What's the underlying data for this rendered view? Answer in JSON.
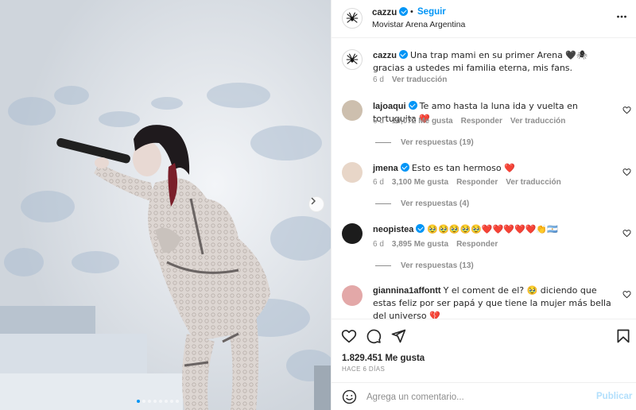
{
  "colors": {
    "accent": "#0095f6",
    "text": "#262626",
    "muted": "#8e8e8e",
    "like_red": "#ed4956"
  },
  "media": {
    "slide_index": 1,
    "slide_count": 8,
    "next_icon": "chevron-right-icon"
  },
  "header": {
    "username": "cazzu",
    "separator": "•",
    "follow_label": "Seguir",
    "location": "Movistar Arena Argentina",
    "more_icon": "more-horizontal-icon"
  },
  "caption": {
    "username": "cazzu",
    "text": "Una trap mami en su primer Arena 🖤🕷 gracias a ustedes mi familia eterna, mis fans.",
    "time": "6 d",
    "translate": "Ver traducción"
  },
  "comments": [
    {
      "username": "lajoaqui",
      "verified": true,
      "text": "Te amo hasta la luna ida y vuelta en tortuguita ❤️",
      "time": "6 d",
      "likes": "10,072 Me gusta",
      "reply": "Responder",
      "translate": "Ver traducción",
      "replies": "Ver respuestas (19)"
    },
    {
      "username": "jmena",
      "verified": true,
      "text": "Esto es tan hermoso ❤️",
      "time": "6 d",
      "likes": "3,100 Me gusta",
      "reply": "Responder",
      "translate": "Ver traducción",
      "replies": "Ver respuestas (4)"
    },
    {
      "username": "neopistea",
      "verified": true,
      "text": "🥹🥹🥹🥹🥹❤️❤️❤️❤️❤️👏🇦🇷",
      "time": "6 d",
      "likes": "3,895 Me gusta",
      "reply": "Responder",
      "replies": "Ver respuestas (13)"
    },
    {
      "username": "giannina1affontt",
      "verified": false,
      "text": "Y el coment de el? 🥹 diciendo que estas feliz por ser papá y que tiene la mujer más bella del universo 💔"
    }
  ],
  "actions": {
    "like_icon": "heart-icon",
    "comment_icon": "comment-icon",
    "share_icon": "send-icon",
    "save_icon": "bookmark-icon",
    "likes_count": "1.829.451 Me gusta",
    "time_ago": "HACE 6 DÍAS"
  },
  "add_comment": {
    "placeholder": "Agrega un comentario...",
    "post_label": "Publicar",
    "emoji_icon": "emoji-icon"
  }
}
